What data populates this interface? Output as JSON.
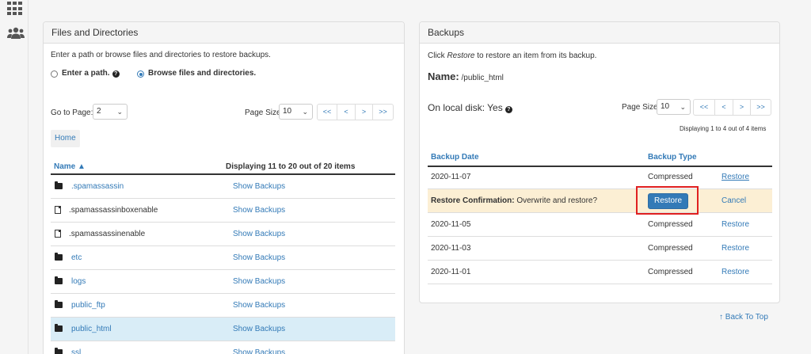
{
  "files_panel": {
    "title": "Files and Directories",
    "intro": "Enter a path or browse files and directories to restore backups.",
    "option_path": "Enter a path.",
    "option_browse": "Browse files and directories.",
    "goto_label": "Go to Page:",
    "goto_value": "2",
    "page_size_label": "Page Size",
    "page_size_value": "10",
    "pager": [
      "<<",
      "<",
      ">",
      ">>"
    ],
    "home_crumb": "Home",
    "col_name": "Name ▲",
    "col_display": "Displaying 11 to 20 out of 20 items",
    "action_label": "Show Backups",
    "rows": [
      {
        "name": ".spamassassin",
        "type": "folder",
        "is_link": true
      },
      {
        "name": ".spamassassinboxenable",
        "type": "file",
        "is_link": false
      },
      {
        "name": ".spamassassinenable",
        "type": "file",
        "is_link": false
      },
      {
        "name": "etc",
        "type": "folder",
        "is_link": true
      },
      {
        "name": "logs",
        "type": "folder",
        "is_link": true
      },
      {
        "name": "public_ftp",
        "type": "folder",
        "is_link": true
      },
      {
        "name": "public_html",
        "type": "folder",
        "is_link": true,
        "selected": true
      },
      {
        "name": "ssl",
        "type": "folder",
        "is_link": true
      }
    ]
  },
  "backups_panel": {
    "title": "Backups",
    "intro_prefix": "Click ",
    "intro_em": "Restore",
    "intro_suffix": " to restore an item from its backup.",
    "name_label": "Name:",
    "name_value": "/public_html",
    "local_disk": "On local disk: Yes",
    "page_size_label": "Page Size",
    "page_size_value": "10",
    "pager": [
      "<<",
      "<",
      ">",
      ">>"
    ],
    "display_info": "Displaying 1 to 4 out of 4 items",
    "col_date": "Backup Date",
    "col_type": "Backup Type",
    "confirm_bold": "Restore Confirmation:",
    "confirm_text": " Overwrite and restore?",
    "confirm_button": "Restore",
    "confirm_cancel": "Cancel",
    "restore_label": "Restore",
    "rows": [
      {
        "date": "2020-11-07",
        "type": "Compressed"
      },
      {
        "date": "2020-11-05",
        "type": "Compressed"
      },
      {
        "date": "2020-11-03",
        "type": "Compressed"
      },
      {
        "date": "2020-11-01",
        "type": "Compressed"
      }
    ]
  },
  "back_to_top": "Back To Top"
}
